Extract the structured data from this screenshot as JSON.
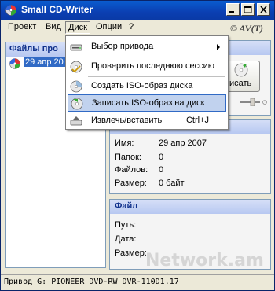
{
  "window": {
    "title": "Small CD-Writer"
  },
  "menubar": {
    "items": [
      "Проект",
      "Вид",
      "Диск",
      "Опции",
      "?"
    ],
    "copyright": "© AV(T)"
  },
  "dropdown": {
    "items": [
      {
        "label": "Выбор привода",
        "icon": "drive-icon",
        "submenu": true
      },
      {
        "label": "Проверить последнюю сессию",
        "icon": "disc-check-icon"
      },
      {
        "label": "Создать ISO-образ диска",
        "icon": "disc-iso-icon"
      },
      {
        "label": "Записать ISO-образ на диск",
        "icon": "burn-iso-icon",
        "highlighted": true
      },
      {
        "label": "Извлечь/вставить",
        "icon": "eject-icon",
        "shortcut": "Ctrl+J"
      }
    ]
  },
  "left_panel": {
    "header": "Файлы про",
    "tree": [
      {
        "label": "29 апр 20"
      }
    ]
  },
  "write_button": {
    "label": "писать"
  },
  "info": {
    "rows": [
      {
        "label": "Имя:",
        "value": "29 апр 2007"
      },
      {
        "label": "Папок:",
        "value": "0"
      },
      {
        "label": "Файлов:",
        "value": "0"
      },
      {
        "label": "Размер:",
        "value": "0 байт"
      }
    ]
  },
  "file": {
    "header": "Файл",
    "rows": [
      {
        "label": "Путь:",
        "value": ""
      },
      {
        "label": "Дата:",
        "value": ""
      },
      {
        "label": "Размер:",
        "value": ""
      }
    ]
  },
  "status": {
    "text": "Привод  G: PIONEER DVD-RW DVR-110D1.17"
  },
  "watermark": "Network.am",
  "colors": {
    "title_bar": "#0b3fb2",
    "selection": "#316ac5",
    "menu_highlight": "#c1d2ee",
    "group_header": "#10318c"
  }
}
